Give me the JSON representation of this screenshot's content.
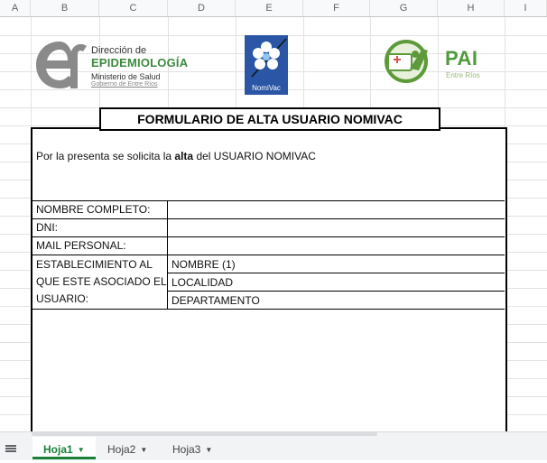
{
  "columns": [
    "A",
    "B",
    "C",
    "D",
    "E",
    "F",
    "G",
    "H",
    "I"
  ],
  "logos": {
    "epi": {
      "line1": "Dirección de",
      "line2": "EPIDEMIOLOGÍA",
      "line3": "Ministerio de Salud",
      "line4": "Gobierno de Entre Ríos"
    },
    "nomivac": {
      "label": "NomiVac"
    },
    "pai": {
      "title": "PAI",
      "subtitle": "Entre Ríos"
    }
  },
  "form": {
    "title": "FORMULARIO DE ALTA USUARIO NOMIVAC",
    "intro_before": "Por la presenta se solicita la ",
    "intro_bold": "alta",
    "intro_after": " del USUARIO NOMIVAC",
    "fields": {
      "nombre": "NOMBRE COMPLETO:",
      "dni": "DNI:",
      "mail": "MAIL PERSONAL:",
      "est_line1": "ESTABLECIMIENTO AL",
      "est_line2": "QUE ESTE ASOCIADO EL",
      "est_line3": "USUARIO:"
    },
    "est_subfields": [
      "NOMBRE (1)",
      "LOCALIDAD",
      "DEPARTAMENTO"
    ]
  },
  "sheets": {
    "tabs": [
      "Hoja1",
      "Hoja2",
      "Hoja3"
    ],
    "active": "Hoja1"
  },
  "colors": {
    "accent_green": "#188038",
    "epi_green": "#3c8a3e",
    "nomivac_blue": "#2b56a5",
    "pai_green": "#4f9a3c"
  },
  "icons": {
    "all_sheets": "hamburger-menu-icon",
    "tab_menu": "caret-down-icon"
  }
}
